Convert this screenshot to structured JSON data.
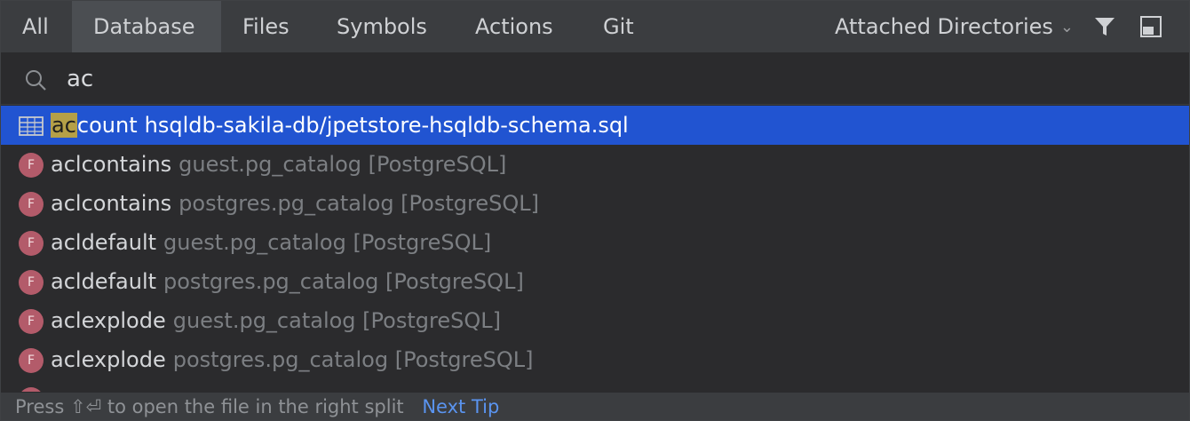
{
  "tabs": [
    {
      "label": "All",
      "selected": false
    },
    {
      "label": "Database",
      "selected": true
    },
    {
      "label": "Files",
      "selected": false
    },
    {
      "label": "Symbols",
      "selected": false
    },
    {
      "label": "Actions",
      "selected": false
    },
    {
      "label": "Git",
      "selected": false
    }
  ],
  "scope": {
    "label": "Attached Directories"
  },
  "search": {
    "value": "ac",
    "placeholder": ""
  },
  "results": [
    {
      "highlight": "ac",
      "rest": "count",
      "location": "hsqldb-sakila-db/jpetstore-hsqldb-schema.sql",
      "icon": "table-icon",
      "selected": true
    },
    {
      "name": "aclcontains",
      "location": "guest.pg_catalog [PostgreSQL]",
      "icon": "function-icon"
    },
    {
      "name": "aclcontains",
      "location": "postgres.pg_catalog [PostgreSQL]",
      "icon": "function-icon"
    },
    {
      "name": "acldefault",
      "location": "guest.pg_catalog [PostgreSQL]",
      "icon": "function-icon"
    },
    {
      "name": "acldefault",
      "location": "postgres.pg_catalog [PostgreSQL]",
      "icon": "function-icon"
    },
    {
      "name": "aclexplode",
      "location": "guest.pg_catalog [PostgreSQL]",
      "icon": "function-icon"
    },
    {
      "name": "aclexplode",
      "location": "postgres.pg_catalog [PostgreSQL]",
      "icon": "function-icon"
    }
  ],
  "function_badge": "F",
  "footer": {
    "press": "Press",
    "keys": "⇧⏎",
    "text": "to open the file in the right split",
    "next_tip": "Next Tip"
  },
  "colors": {
    "selection": "#2154d1",
    "highlight": "#b5a047",
    "function_badge": "#b35b6a",
    "link": "#5a94f0"
  }
}
